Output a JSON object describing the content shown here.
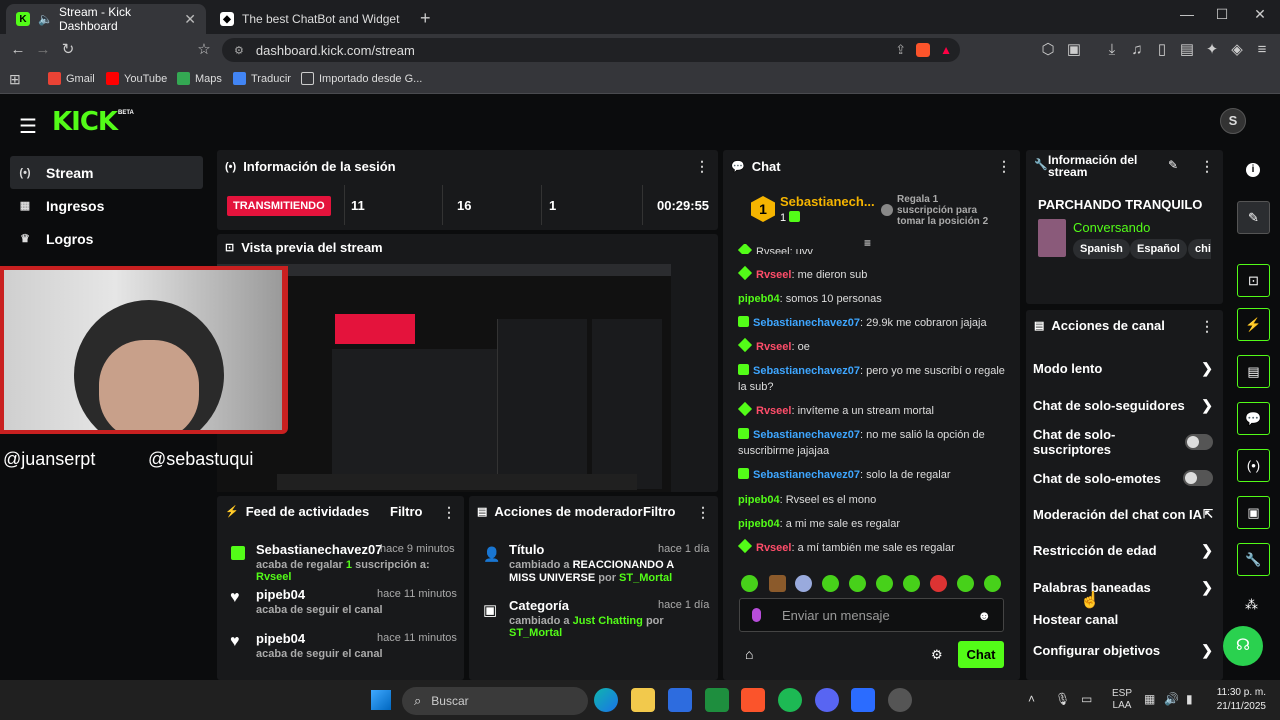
{
  "browser": {
    "tabs": [
      {
        "title": "Stream - Kick Dashboard"
      },
      {
        "title": "The best ChatBot and Widgets for Ki"
      }
    ],
    "url": "dashboard.kick.com/stream",
    "bookmarks": [
      "Gmail",
      "YouTube",
      "Maps",
      "Traducir",
      "Importado desde G..."
    ]
  },
  "app": {
    "logo": "KICK",
    "beta": "BETA",
    "sidebar": [
      {
        "label": "Stream",
        "icon": "broadcast-icon"
      },
      {
        "label": "Ingresos",
        "icon": "chart-icon"
      },
      {
        "label": "Logros",
        "icon": "trophy-icon"
      }
    ],
    "session": {
      "title": "Información de la sesión",
      "status": "TRANSMITIENDO",
      "stats": [
        "11",
        "16",
        "1"
      ],
      "time": "00:29:55"
    },
    "preview": {
      "title": "Vista previa del stream"
    },
    "overlay": {
      "handle1": "@juanserpt",
      "handle2": "@sebastuqui"
    },
    "feed": {
      "title": "Feed de actividades",
      "filter": "Filtro",
      "items": [
        {
          "user": "Sebastianechavez07",
          "time": "hace 9 minutos",
          "pre": "acaba de regalar",
          "num": "1",
          "mid": "suscripción a:",
          "target": "Rvseel"
        },
        {
          "user": "pipeb04",
          "time": "hace 11 minutos",
          "text": "acaba de seguir el canal"
        },
        {
          "user": "pipeb04",
          "time": "hace 11 minutos",
          "text": "acaba de seguir el canal"
        }
      ]
    },
    "mod": {
      "title": "Acciones de moderador",
      "filter": "Filtro",
      "items": [
        {
          "title": "Título",
          "time": "hace 1 día",
          "pre": "cambiado a",
          "value": "REACCIONANDO A MISS UNIVERSE",
          "by": "por",
          "who": "ST_Mortal"
        },
        {
          "title": "Categoría",
          "time": "hace 1 día",
          "pre": "cambiado a",
          "value": "Just Chatting",
          "by": "por",
          "who": "ST_Mortal"
        }
      ]
    },
    "chat": {
      "title": "Chat",
      "top_user": "Sebastianech...",
      "top_rank": "1",
      "top_count": "1",
      "gift_hint": "Regala 1 suscripción para tomar la posición 2",
      "partial": "Rvseel: uyy",
      "messages": [
        {
          "user": "Rvseel",
          "text": "me dieron sub"
        },
        {
          "user": "pipeb04",
          "text": "somos 10 personas"
        },
        {
          "user": "Sebastianechavez07",
          "text": "29.9k me cobraron jajaja"
        },
        {
          "user": "Rvseel",
          "text": "oe"
        },
        {
          "user": "Sebastianechavez07",
          "text": "pero yo me suscribí o regale la sub?"
        },
        {
          "user": "Rvseel",
          "text": "invíteme a un stream mortal"
        },
        {
          "user": "Sebastianechavez07",
          "text": "no me salió la opción de suscribirme jajajaa"
        },
        {
          "user": "Sebastianechavez07",
          "text": "solo la de regalar"
        },
        {
          "user": "pipeb04",
          "text": "Rvseel es el mono"
        },
        {
          "user": "pipeb04",
          "text": "a mi me sale es regalar"
        },
        {
          "user": "Rvseel",
          "text": "a mí también me sale es regalar"
        }
      ],
      "placeholder": "Enviar un mensaje",
      "send": "Chat"
    },
    "info": {
      "title": "Información del stream",
      "stream_title": "PARCHANDO TRANQUILO",
      "category": "Conversando",
      "tags": [
        "Spanish",
        "Español",
        "chi"
      ]
    },
    "channel": {
      "title": "Acciones de canal",
      "items": [
        {
          "label": "Modo lento",
          "kind": "arrow"
        },
        {
          "label": "Chat de solo-seguidores",
          "kind": "arrow"
        },
        {
          "label": "Chat de solo-suscriptores",
          "kind": "toggle"
        },
        {
          "label": "Chat de solo-emotes",
          "kind": "toggle"
        },
        {
          "label": "Moderación del chat con IA",
          "kind": "external"
        },
        {
          "label": "Restricción de edad",
          "kind": "arrow"
        },
        {
          "label": "Palabras baneadas",
          "kind": "arrow"
        },
        {
          "label": "Hostear canal",
          "kind": "none"
        },
        {
          "label": "Configurar objetivos",
          "kind": "arrow"
        }
      ]
    }
  },
  "taskbar": {
    "search": "Buscar",
    "lang1": "ESP",
    "lang2": "LAA",
    "time": "11:30 p. m.",
    "date": "21/11/2025"
  },
  "colors": {
    "accent": "#53fc18",
    "live": "#e4133c"
  }
}
